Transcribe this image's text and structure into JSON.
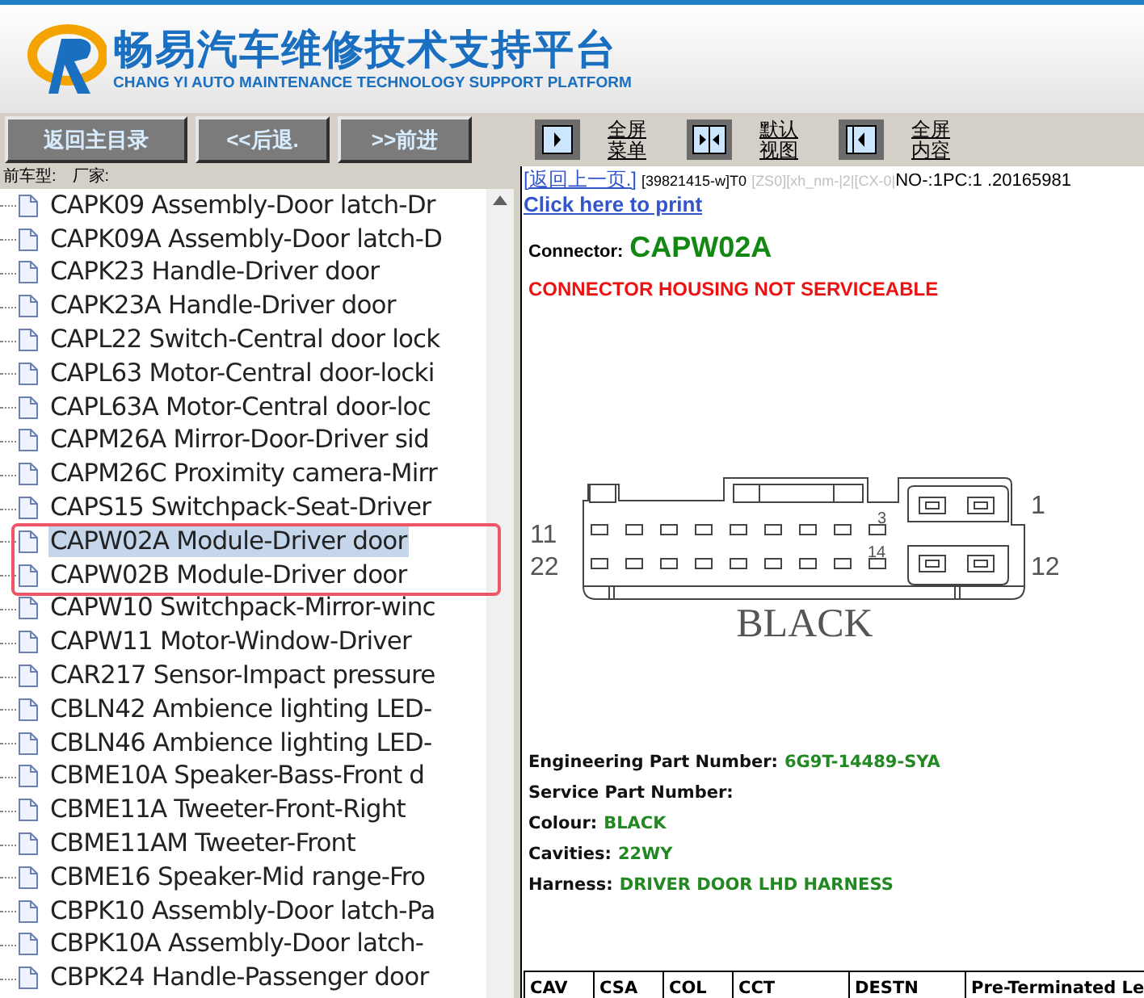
{
  "header": {
    "title": "畅易汽车维修技术支持平台",
    "subtitle": "CHANG YI AUTO MAINTENANCE TECHNOLOGY SUPPORT PLATFORM"
  },
  "nav_buttons": [
    "返回主目录",
    "<<后退.",
    ">>前进"
  ],
  "view_buttons": [
    {
      "kind": "menu",
      "lines": [
        "全屏",
        "菜单"
      ]
    },
    {
      "kind": "split",
      "lines": [
        "默认",
        "视图"
      ]
    },
    {
      "kind": "content",
      "lines": [
        "全屏",
        "内容"
      ]
    }
  ],
  "tree": {
    "model_label": "前车型:",
    "maker_label": "厂家:",
    "items": [
      {
        "label": "CAPK09 Assembly-Door latch-Dr",
        "selected": false,
        "flagged": false
      },
      {
        "label": "CAPK09A Assembly-Door latch-D",
        "selected": false,
        "flagged": false
      },
      {
        "label": "CAPK23 Handle-Driver door",
        "selected": false,
        "flagged": false
      },
      {
        "label": "CAPK23A Handle-Driver door",
        "selected": false,
        "flagged": false
      },
      {
        "label": "CAPL22 Switch-Central door lock",
        "selected": false,
        "flagged": false
      },
      {
        "label": "CAPL63 Motor-Central door-locki",
        "selected": false,
        "flagged": false
      },
      {
        "label": "CAPL63A Motor-Central door-loc",
        "selected": false,
        "flagged": false
      },
      {
        "label": "CAPM26A Mirror-Door-Driver sid",
        "selected": false,
        "flagged": false
      },
      {
        "label": "CAPM26C Proximity camera-Mirr",
        "selected": false,
        "flagged": false
      },
      {
        "label": "CAPS15 Switchpack-Seat-Driver",
        "selected": false,
        "flagged": false
      },
      {
        "label": "CAPW02A Module-Driver door",
        "selected": true,
        "flagged": true
      },
      {
        "label": "CAPW02B Module-Driver door",
        "selected": false,
        "flagged": true
      },
      {
        "label": "CAPW10 Switchpack-Mirror-winc",
        "selected": false,
        "flagged": false
      },
      {
        "label": "CAPW11 Motor-Window-Driver",
        "selected": false,
        "flagged": false
      },
      {
        "label": "CAR217 Sensor-Impact pressure",
        "selected": false,
        "flagged": false
      },
      {
        "label": "CBLN42 Ambience lighting LED-",
        "selected": false,
        "flagged": false
      },
      {
        "label": "CBLN46 Ambience lighting LED-",
        "selected": false,
        "flagged": false
      },
      {
        "label": "CBME10A Speaker-Bass-Front d",
        "selected": false,
        "flagged": false
      },
      {
        "label": "CBME11A Tweeter-Front-Right",
        "selected": false,
        "flagged": false
      },
      {
        "label": "CBME11AM Tweeter-Front",
        "selected": false,
        "flagged": false
      },
      {
        "label": "CBME16 Speaker-Mid range-Fro",
        "selected": false,
        "flagged": false
      },
      {
        "label": "CBPK10 Assembly-Door latch-Pa",
        "selected": false,
        "flagged": false
      },
      {
        "label": "CBPK10A Assembly-Door latch-",
        "selected": false,
        "flagged": false
      },
      {
        "label": "CBPK24 Handle-Passenger door",
        "selected": false,
        "flagged": false
      }
    ]
  },
  "content": {
    "back_link": "[返回上一页.]",
    "code": "[39821415-w]T0",
    "muted_code": "[ZS0][xh_nm-|2|[CX-0|",
    "session": "NO-:1PC:1 .20165981",
    "print_link": "Click here to print",
    "connector": {
      "label": "Connector:",
      "value": "CAPW02A"
    },
    "warning": "CONNECTOR HOUSING NOT SERVICEABLE",
    "diagram": {
      "pins": [
        "11",
        "22",
        "3",
        "14",
        "1",
        "12"
      ],
      "colour_label": "BLACK"
    },
    "details": [
      {
        "label": "Engineering Part Number:",
        "value": "6G9T-14489-SYA"
      },
      {
        "label": "Service Part Number:"
      },
      {
        "label": "Colour:",
        "value": "BLACK"
      },
      {
        "label": "Cavities:",
        "value": "22WY"
      },
      {
        "label": "Harness:",
        "value": "DRIVER DOOR LHD HARNESS"
      }
    ],
    "table": {
      "columns": [
        "CAV",
        "CSA",
        "COL",
        "CCT",
        "DESTN",
        "Pre-Terminated Le"
      ]
    }
  }
}
